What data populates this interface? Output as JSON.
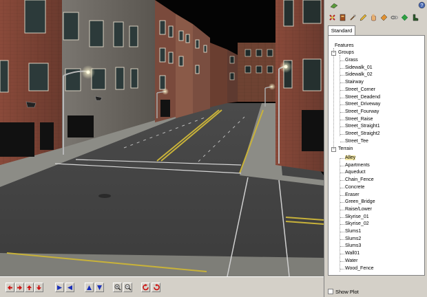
{
  "palette": {
    "tab_label": "Standard",
    "tools": [
      "eraser-tool-icon",
      "book-tool-icon",
      "axe-tool-icon",
      "pencil-tool-icon",
      "hand-tool-icon",
      "dropper-tool-icon",
      "link-tool-icon",
      "gem-tool-icon",
      "boot-tool-icon"
    ]
  },
  "tree": {
    "root_label": "Features",
    "groups_label": "Groups",
    "groups": [
      "Grass",
      "Sidewalk_01",
      "Sidewalk_02",
      "Stairway",
      "Street_Corner",
      "Street_Deadend",
      "Street_Driveway",
      "Street_Fourway",
      "Street_Raise",
      "Street_Straight1",
      "Street_Straight2",
      "Street_Tee"
    ],
    "terrain_label": "Terrain",
    "terrain": [
      "Alley",
      "Apartments",
      "Aqueduct",
      "Chain_Fence",
      "Concrete",
      "Eraser",
      "Green_Bridge",
      "Raise/Lower",
      "Skyrise_01",
      "Skyrise_02",
      "Slums1",
      "Slums2",
      "Slums3",
      "Wall01",
      "Water",
      "Wood_Fence"
    ],
    "selected": "Alley",
    "expander_symbol": "−"
  },
  "show_plot": {
    "label": "Show Plot",
    "checked": false
  },
  "toolbar": {
    "buttons": [
      "pan-left-icon",
      "pan-right-icon",
      "move-up-icon",
      "move-down-icon",
      "rotate-left-icon",
      "rotate-right-icon",
      "tilt-up-icon",
      "tilt-down-icon",
      "zoom-in-icon",
      "zoom-out-icon",
      "rotate-cw-icon",
      "rotate-ccw-icon"
    ]
  },
  "colors": {
    "arrow_red": "#cc1111",
    "arrow_blue": "#1a2fb8",
    "selection": "#f5e9a6"
  }
}
